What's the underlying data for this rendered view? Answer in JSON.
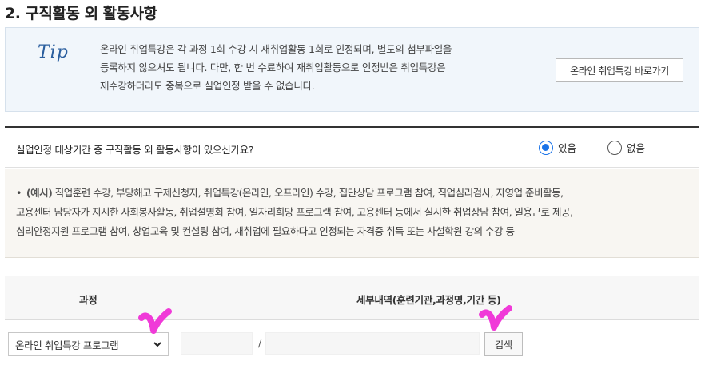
{
  "section": {
    "title": "2. 구직활동 외 활동사항"
  },
  "tip": {
    "mark": "Tip",
    "lines": [
      "온라인 취업특강은 각 과정 1회 수강 시 재취업활동 1회로 인정되며, 별도의 첨부파일을",
      "등록하지 않으셔도 됩니다. 다만, 한 번 수료하여 재취업활동으로 인정받은 취업특강은",
      "재수강하더라도 중복으로 실업인정 받을 수 없습니다."
    ],
    "button_label": "온라인 취업특강 바로가기"
  },
  "question": {
    "text": "실업인정 대상기간 중 구직활동 외 활동사항이 있으신가요?",
    "options": [
      {
        "label": "있음",
        "selected": true
      },
      {
        "label": "없음",
        "selected": false
      }
    ]
  },
  "example": {
    "bullet": "•",
    "label": "(예시)",
    "line1": " 직업훈련 수강, 부당해고 구제신청자, 취업특강(온라인, 오프라인) 수강, 집단상담 프로그램 참여, 직업심리검사, 자영업 준비활동,",
    "line2": "고용센터 담당자가 지시한 사회봉사활동, 취업설명회 참여, 일자리희망 프로그램 참여, 고용센터 등에서 실시한 취업상담 참여, 일용근로 제공,",
    "line3": "심리안정지원 프로그램 참여, 창업교육 및 컨설팅 참여, 재취업에 필요하다고 인정되는 자격증 취득 또는 사설학원 강의 수강 등"
  },
  "table": {
    "headers": {
      "course": "과정",
      "details": "세부내역(훈련기관,과정명,기간 등)"
    },
    "row": {
      "course_select_value": "온라인 취업특강 프로그램",
      "separator": "/",
      "search_label": "검색"
    }
  },
  "colors": {
    "accent": "#1a73e8",
    "annotation": "#f03ad8",
    "tip_mark": "#2a5e9e"
  }
}
